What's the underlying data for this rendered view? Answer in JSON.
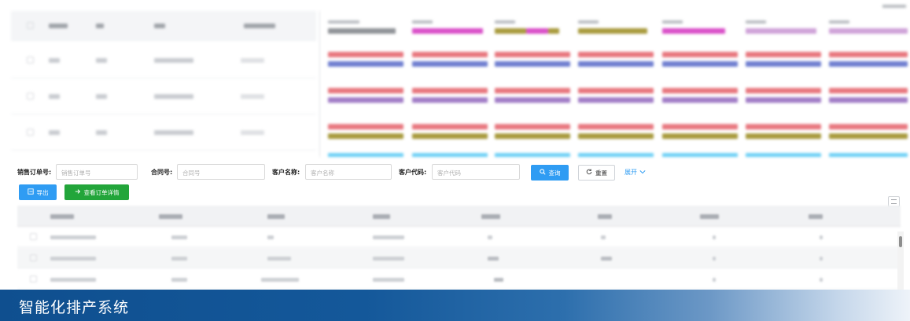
{
  "filter_form": {
    "sales_order_label": "销售订单号:",
    "sales_order_placeholder": "销售订单号",
    "contract_label": "合同号:",
    "contract_placeholder": "合同号",
    "customer_name_label": "客户名称:",
    "customer_name_placeholder": "客户名称",
    "customer_code_label": "客户代码:",
    "customer_code_placeholder": "客户代码",
    "search_label": "查询",
    "reset_label": "重置",
    "expand_label": "展开"
  },
  "toolbar": {
    "export_label": "导出",
    "view_detail_label": "查看订单详情"
  },
  "colors": {
    "primary": "#2f9cf3",
    "success": "#22a53a",
    "banner_start": "#0f4f8f",
    "gantt_red": "#e8777f",
    "gantt_blue": "#6f7fd0",
    "gantt_purple": "#a17cc7",
    "gantt_olive": "#a89a3c",
    "gantt_magenta": "#d94fc9",
    "gantt_cyan": "#6ccff5"
  },
  "icons": {
    "export": "export-icon",
    "view_detail": "arrow-right-icon",
    "search": "search-icon",
    "reset": "refresh-icon",
    "expand": "chevron-down-icon",
    "column_setting": "column-setting-icon"
  },
  "banner": {
    "title": "智能化排产系统"
  }
}
